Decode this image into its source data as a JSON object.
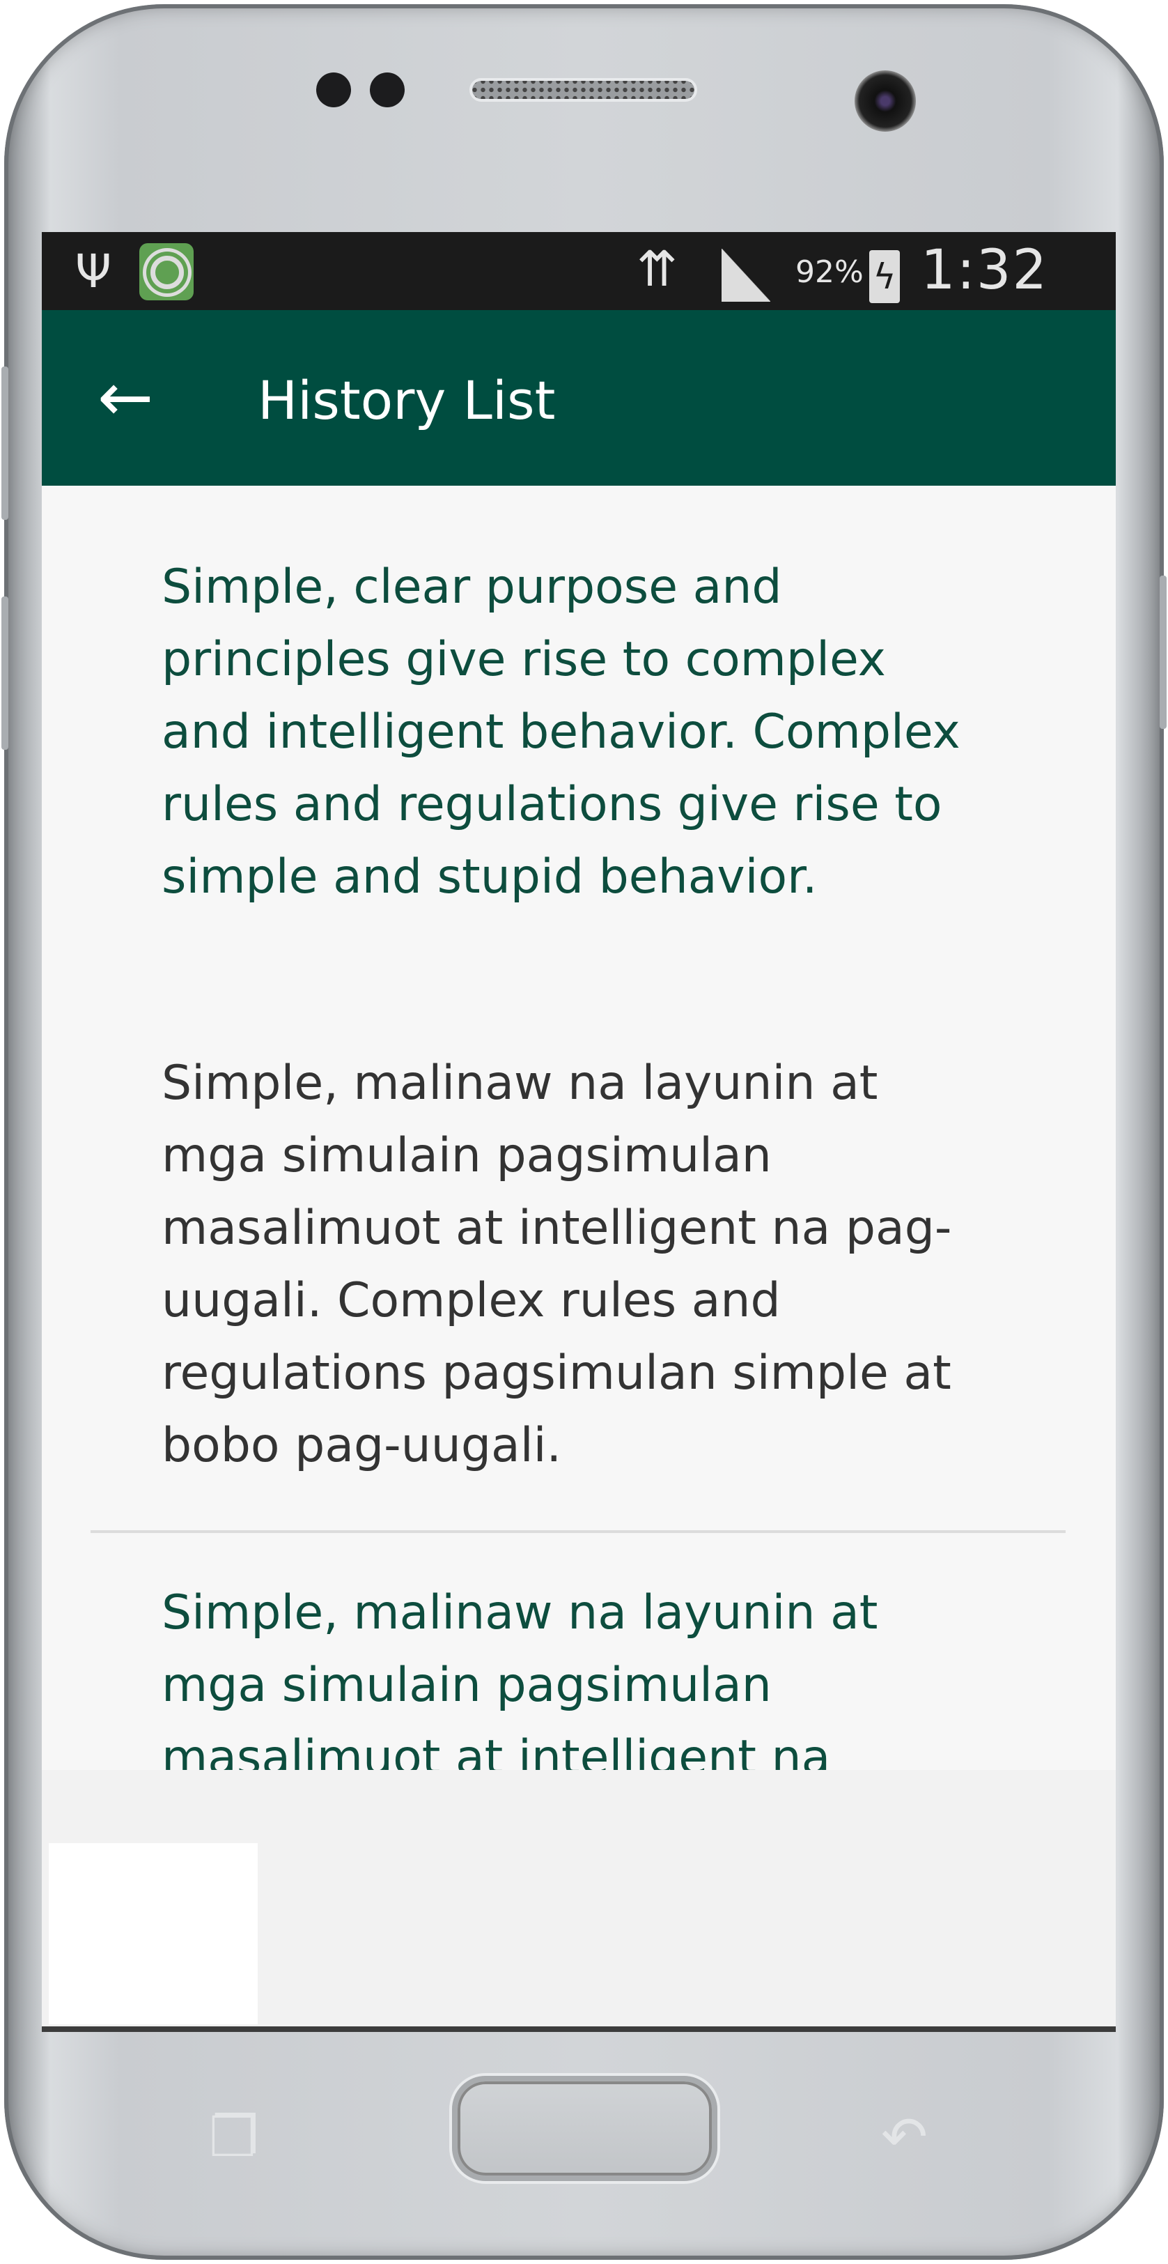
{
  "status_bar": {
    "usb_icon": "usb-icon",
    "app_icon": "target-app-icon",
    "wifi_icon": "wifi-icon",
    "signal_icon": "signal-icon",
    "battery_percent": "92%",
    "battery_icon": "battery-charging-icon",
    "time": "1:32 PM"
  },
  "app_bar": {
    "back_icon": "arrow-left-icon",
    "title": "History List",
    "background": "#004d40"
  },
  "history": [
    {
      "source": "Simple, clear purpose and principles give rise to complex and intelligent behavior. Complex rules and regulations give rise to simple and stupid behavior.",
      "translation": "Simple, malinaw na layunin at mga simulain pagsimulan masalimuot at intelligent na pag-uugali. Complex rules and regulations pagsimulan simple at bobo pag-uugali."
    },
    {
      "source": "Simple, malinaw na layunin at mga simulain pagsimulan masalimuot at intelligent na"
    }
  ],
  "colors": {
    "source_text": "#0d4d3e",
    "translation_text": "#333333"
  }
}
